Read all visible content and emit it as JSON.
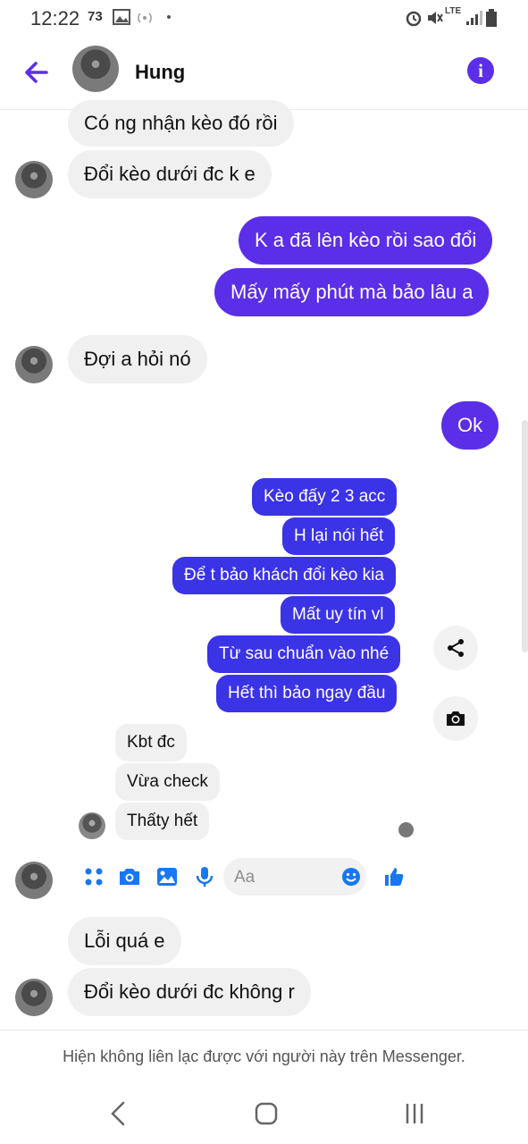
{
  "status_bar": {
    "time": "12:22",
    "badge": "73",
    "network": "LTE"
  },
  "header": {
    "contact_name": "Hung",
    "info_label": "i"
  },
  "messages": [
    {
      "text": "Có ng nhận kèo đó rồi",
      "side": "in"
    },
    {
      "text": "Đổi kèo dưới đc k e",
      "side": "in"
    },
    {
      "text": "K a đã lên kèo rồi sao đổi",
      "side": "out"
    },
    {
      "text": "Mấy mấy phút mà bảo lâu a",
      "side": "out"
    },
    {
      "text": "Đợi a hỏi nó",
      "side": "in"
    },
    {
      "text": "Ok",
      "side": "out"
    }
  ],
  "quoted_out": [
    "Kèo đấy 2 3 acc",
    "H lại nói hết",
    "Để t bảo khách đổi kèo kia",
    "Mất uy tín vl",
    "Từ sau chuẩn vào nhé",
    "Hết thì bảo ngay đầu"
  ],
  "quoted_in": [
    "Kbt đc",
    "Vừa check",
    "Thấty hết"
  ],
  "composer": {
    "placeholder": "Aa"
  },
  "later_messages": [
    {
      "text": "Lỗi quá e",
      "side": "in"
    },
    {
      "text": "Đổi kèo dưới đc không r",
      "side": "in"
    }
  ],
  "notice": "Hiện không liên lạc được với người này trên Messenger.",
  "colors": {
    "accent": "#5b2ee8",
    "bubble_in": "#f1f0f0"
  }
}
